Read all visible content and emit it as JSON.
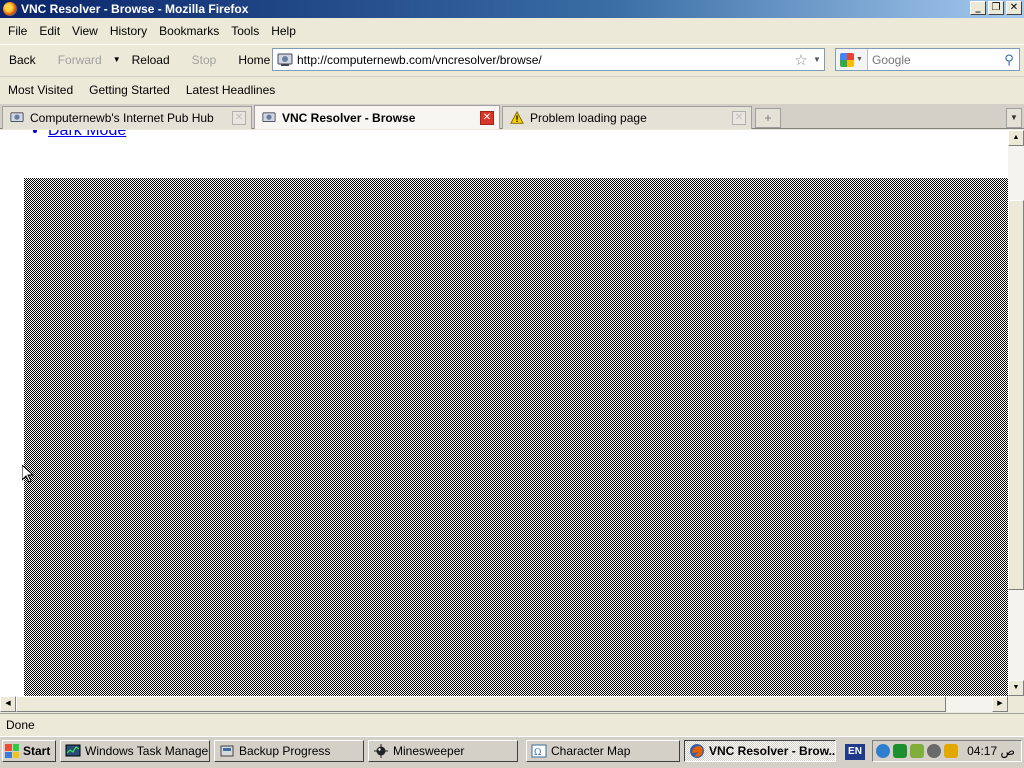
{
  "window": {
    "title": "VNC Resolver - Browse - Mozilla Firefox"
  },
  "menu": [
    "File",
    "Edit",
    "View",
    "History",
    "Bookmarks",
    "Tools",
    "Help"
  ],
  "nav": {
    "back": "Back",
    "forward": "Forward",
    "reload": "Reload",
    "stop": "Stop",
    "home": "Home",
    "url": "http://computernewb.com/vncresolver/browse/",
    "search_placeholder": "Google"
  },
  "bookmarks": [
    "Most Visited",
    "Getting Started",
    "Latest Headlines"
  ],
  "tabs": [
    {
      "label": "Computernewb's Internet Pub Hub",
      "active": false,
      "icon": "site-icon"
    },
    {
      "label": "VNC Resolver - Browse",
      "active": true,
      "icon": "site-icon"
    },
    {
      "label": "Problem loading page",
      "active": false,
      "icon": "warning-icon"
    }
  ],
  "content": {
    "list_link": "Dark Mode"
  },
  "status": {
    "text": "Done"
  },
  "taskbar": {
    "start": "Start",
    "tasks": [
      {
        "label": "Windows Task Manager",
        "icon": "task-manager-icon"
      },
      {
        "label": "Backup Progress",
        "icon": "backup-icon"
      },
      {
        "label": "Minesweeper",
        "icon": "minesweeper-icon"
      },
      {
        "label": "Character Map",
        "icon": "character-map-icon"
      },
      {
        "label": "VNC Resolver - Brow...",
        "icon": "firefox-icon",
        "active": true
      }
    ],
    "language": "EN",
    "clock": "04:17 ص"
  },
  "colors": {
    "titlebar": "#0a246a",
    "link": "#0000ee",
    "active_tab_close": "#d9362a"
  }
}
